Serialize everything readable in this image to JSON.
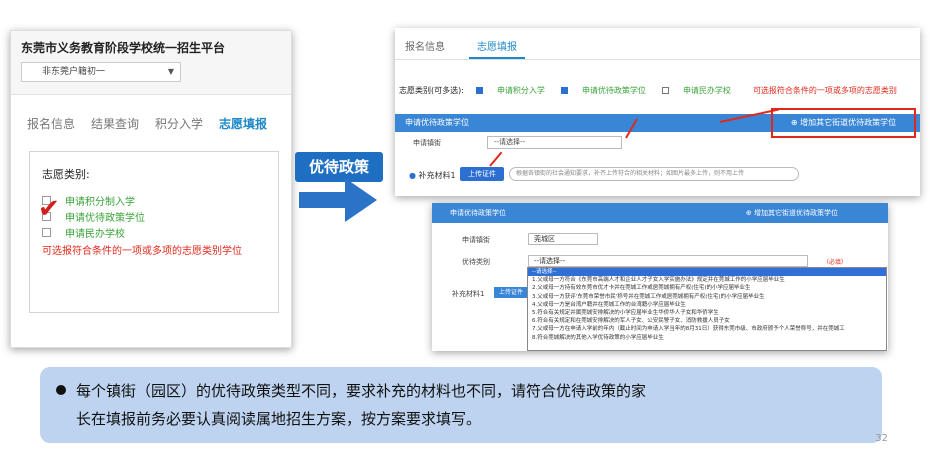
{
  "left_panel": {
    "title": "东莞市义务教育阶段学校统一招生平台",
    "select_value": "非东莞户籍初一",
    "tabs": [
      "报名信息",
      "结果查询",
      "积分入学",
      "志愿填报"
    ],
    "active_tab": 3,
    "type_label": "志愿类别:",
    "options": [
      "申请积分制入学",
      "申请优待政策学位",
      "申请民办学校"
    ],
    "check_mark": "✔",
    "note": "可选报符合条件的一项或多项的志愿类别学位"
  },
  "arrow_label": "优待政策",
  "top_right": {
    "tabs": [
      "报名信息",
      "志愿填报"
    ],
    "type_label": "志愿类别(可多选):",
    "options": [
      "申请积分入学",
      "申请优待政策学位",
      "申请民办学校"
    ],
    "option_checked": [
      true,
      true,
      false
    ],
    "note": "可选报符合条件的一项或多项的志愿类别",
    "section_bar": "申请优待政策学位",
    "add_button": "⊕ 增加其它街道优待政策学位",
    "street_label": "申请镇街",
    "street_select": "--请选择--",
    "material_label": "补充材料1",
    "upload_button": "上传证件",
    "upload_hint": "根据各镇街的社会通知要求，补齐上传符合的相关材料；如图片最多上传，则不用上传"
  },
  "bottom_right": {
    "section_bar": "申请优待政策学位",
    "add_button": "⊕ 增加其它街道优待政策学位",
    "street_label": "申请镇街",
    "street_value": "莞城区",
    "category_label": "优待类别",
    "category_select": "--请选择--",
    "required": "（必填）",
    "material_label": "补充材料1",
    "upload_button": "上传证件",
    "dropdown": [
      "--请选择--",
      "1.父或母一方符合《东莞市高端人才和企业人才子女入学实施办法》规定并在莞城工作的小学应届毕业生",
      "2.父或母一方持有效东莞市优才卡并在莞城工作或居莞城拥有产权(住宅)的小学应届毕业生",
      "3.父或母一方获评'东莞市荣誉市民'称号并在莞城工作或居莞城拥有产权(住宅)的小学应届毕业生",
      "4.父或母一方是台湾户籍并在莞城工作的台湾籍小学应届毕业生",
      "5.符合有关规定并属莞城安排解决的小学应届毕业生华侨华人子女和华侨学生",
      "6.符合有关规定和在莞城安排解决的军人子女、公安民警子女、消防救援人员子女",
      "7.父或母一方在申请入学前的年内（截止时间为申请入学当年的8月31日）获得东莞市级、市政府颁予个人荣誉称号，并在莞城工",
      "8.符合莞城解决的其他入学优待政策的小学应届毕业生"
    ],
    "highlighted_index": 0
  },
  "caption": {
    "line1": "每个镇街（园区）的优待政策类型不同，要求补充的材料也不同，请符合优待政策的家",
    "line2": "长在填报前务必要认真阅读属地招生方案，按方案要求填写。"
  },
  "page_number": "32"
}
